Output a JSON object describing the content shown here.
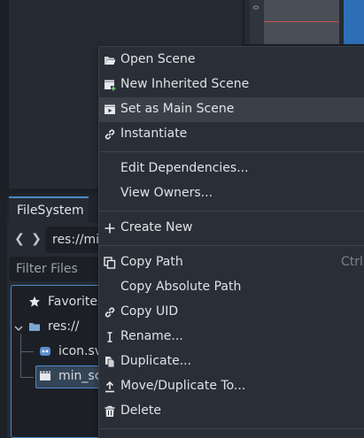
{
  "viewport": {
    "ruler_label": "0"
  },
  "dock": {
    "tab_label": "FileSystem",
    "nav_back": "❮",
    "nav_forward": "❯",
    "path_value": "res://mi",
    "filter_placeholder": "Filter Files",
    "tree": {
      "favorites_label": "Favorites",
      "res_label": "res://",
      "icon_file_label": "icon.sv",
      "scene_file_label": "min_sc"
    }
  },
  "context_menu": {
    "items": [
      {
        "label": "Open Scene",
        "icon": "folder-open-icon"
      },
      {
        "label": "New Inherited Scene",
        "icon": "new-inherited-scene-icon"
      },
      {
        "label": "Set as Main Scene",
        "icon": "main-scene-icon",
        "highlighted": true
      },
      {
        "label": "Instantiate",
        "icon": "link-icon"
      },
      {
        "label": "Edit Dependencies...",
        "icon": ""
      },
      {
        "label": "View Owners...",
        "icon": ""
      },
      {
        "label": "Create New",
        "icon": "plus-icon"
      },
      {
        "label": "Copy Path",
        "icon": "copy-icon",
        "shortcut": "Ctrl+"
      },
      {
        "label": "Copy Absolute Path",
        "icon": ""
      },
      {
        "label": "Copy UID",
        "icon": "link-icon"
      },
      {
        "label": "Rename...",
        "icon": "rename-icon"
      },
      {
        "label": "Duplicate...",
        "icon": "duplicate-icon"
      },
      {
        "label": "Move/Duplicate To...",
        "icon": "move-icon"
      },
      {
        "label": "Delete",
        "icon": "trash-icon"
      }
    ]
  },
  "colors": {
    "accent": "#4c88c7",
    "menu_bg": "#2a2f37",
    "menu_hover": "#3b4048",
    "panel_bg": "#262b33"
  }
}
